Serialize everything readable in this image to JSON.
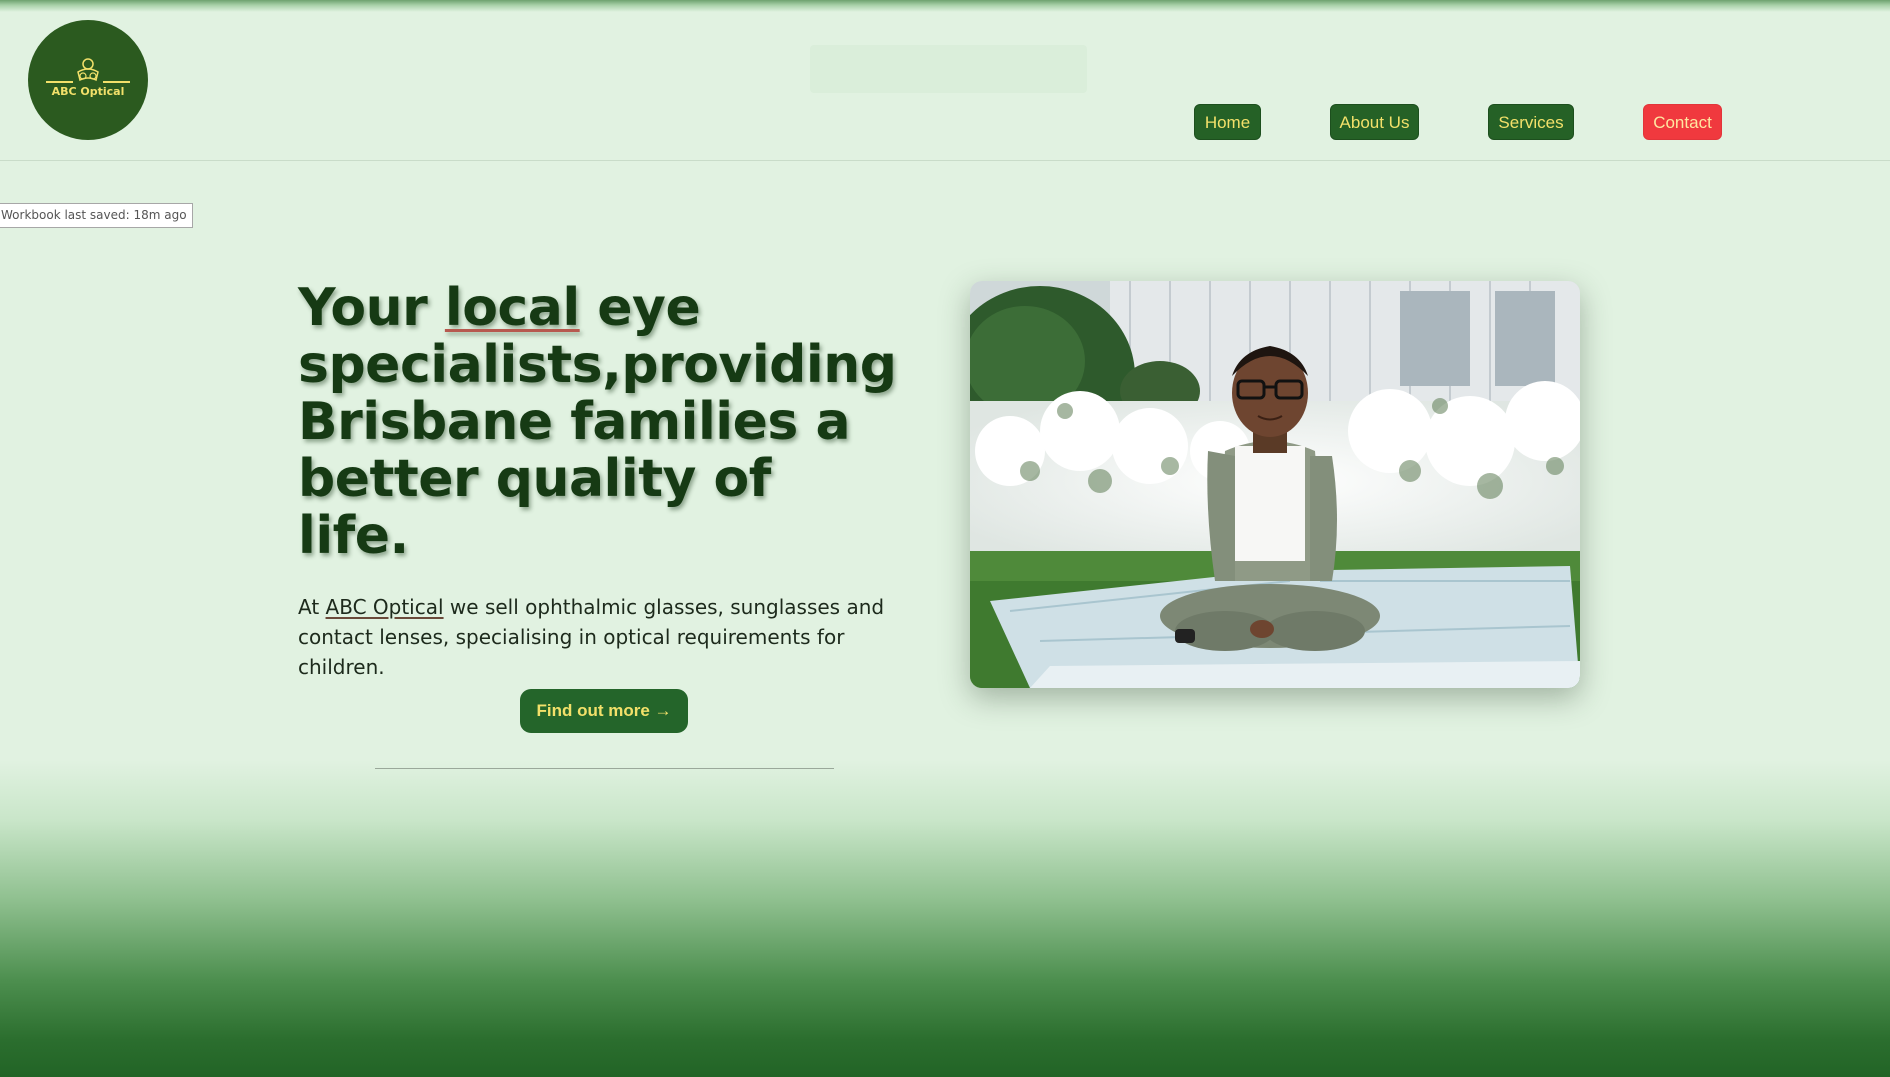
{
  "brand": {
    "logo_text": "ABC Optical"
  },
  "nav": {
    "items": [
      {
        "label": "Home"
      },
      {
        "label": "About Us"
      },
      {
        "label": "Services"
      },
      {
        "label": "Contact"
      }
    ]
  },
  "status": {
    "saved_text": "Workbook last saved: 18m ago"
  },
  "hero": {
    "headline_before": "Your ",
    "headline_highlight": "local",
    "headline_after": " eye specialists,providing Brisbane families a better quality of life.",
    "intro_prefix": "At ",
    "intro_brand": "ABC Optical",
    "intro_rest": " we sell ophthalmic glasses, sunglasses and contact lenses, specialising in optical requirements for children.",
    "cta_label": "Find out more →"
  },
  "colors": {
    "page_background": "#e1f2e1",
    "brand_green": "#256126",
    "accent_yellow": "#f2e06a",
    "contact_red": "#f0393e",
    "headline_green": "#163a14"
  }
}
